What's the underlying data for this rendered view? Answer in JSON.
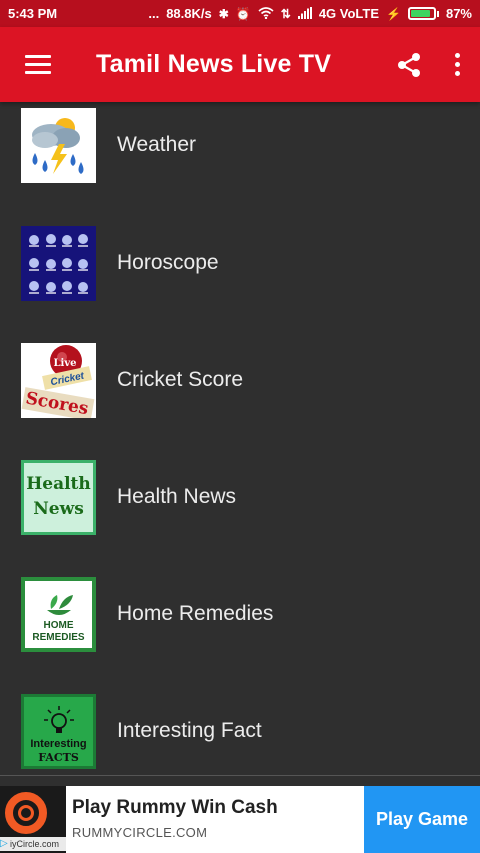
{
  "status_bar": {
    "time": "5:43 PM",
    "dots": "...",
    "net_speed": "88.8K/s",
    "network": "4G VoLTE",
    "battery_percent": "87%",
    "battery_level": 0.87,
    "icons": [
      "bluetooth-icon",
      "alarm-icon",
      "wifi-icon",
      "data-transfer-icon",
      "signal-icon",
      "charging-icon",
      "battery-icon"
    ]
  },
  "app_bar": {
    "title": "Tamil News Live TV",
    "color": "#dc1424",
    "icons": [
      "hamburger-menu-icon",
      "share-icon",
      "more-vert-icon"
    ]
  },
  "list": {
    "items": [
      {
        "label": "Weather",
        "icon": "weather-thumbnail"
      },
      {
        "label": "Horoscope",
        "icon": "horoscope-thumbnail"
      },
      {
        "label": "Cricket Score",
        "icon": "cricket-score-thumbnail",
        "thumb_text": [
          "Live",
          "Cricket",
          "Scores"
        ]
      },
      {
        "label": "Health News",
        "icon": "health-news-thumbnail",
        "thumb_text": [
          "Health",
          "News"
        ]
      },
      {
        "label": "Home Remedies",
        "icon": "home-remedies-thumbnail",
        "thumb_text": [
          "HOME",
          "REMEDIES"
        ]
      },
      {
        "label": "Interesting Fact",
        "icon": "interesting-facts-thumbnail",
        "thumb_text": [
          "Interesting",
          "FACTS"
        ]
      }
    ]
  },
  "ad": {
    "headline": "Play Rummy Win Cash",
    "domain": "RUMMYCIRCLE.COM",
    "cta": "Play Game",
    "logo_text": "iyCircle.com",
    "cta_color": "#2196f3"
  }
}
